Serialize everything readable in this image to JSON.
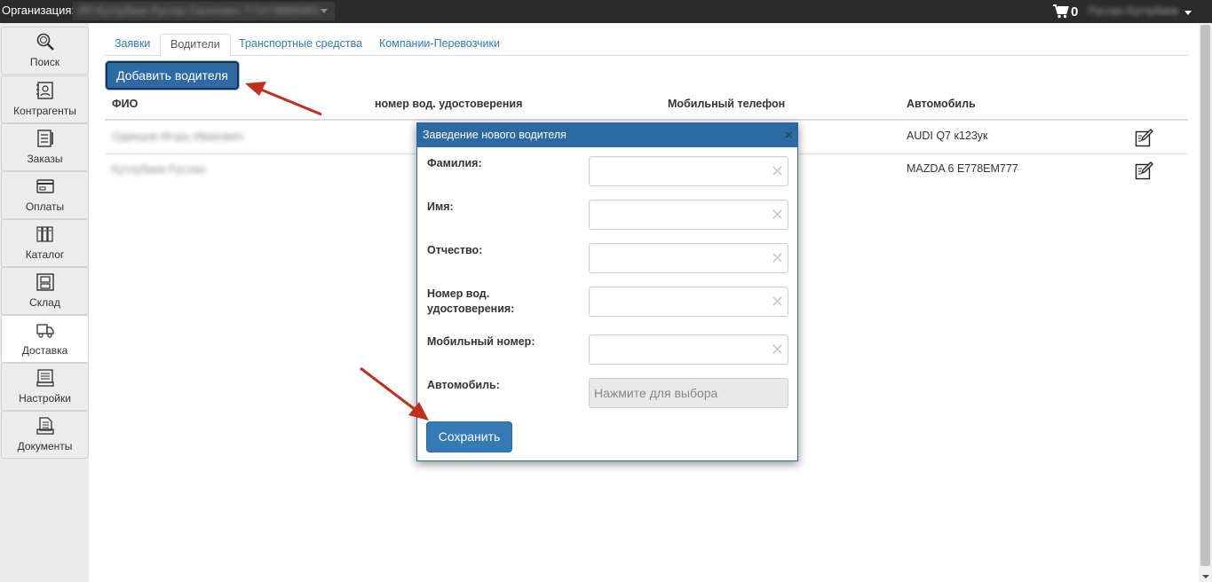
{
  "topbar": {
    "org_label": "Организация:",
    "org_value": "ИП Кутлубаев Руслан Сагитович 7714736855901",
    "cart_count": "0",
    "user_name": "Руслан Кутлубаев"
  },
  "sidebar": {
    "items": [
      {
        "label": "Поиск",
        "icon": "search-icon"
      },
      {
        "label": "Контрагенты",
        "icon": "contacts-icon"
      },
      {
        "label": "Заказы",
        "icon": "orders-icon"
      },
      {
        "label": "Оплаты",
        "icon": "payments-icon"
      },
      {
        "label": "Каталог",
        "icon": "catalog-icon"
      },
      {
        "label": "Склад",
        "icon": "warehouse-icon"
      },
      {
        "label": "Доставка",
        "icon": "delivery-icon"
      },
      {
        "label": "Настройки",
        "icon": "settings-icon"
      },
      {
        "label": "Документы",
        "icon": "documents-icon"
      }
    ],
    "active": "Доставка"
  },
  "tabs": [
    {
      "label": "Заявки"
    },
    {
      "label": "Водители"
    },
    {
      "label": "Транспортные средства"
    },
    {
      "label": "Компании-Перевозчики"
    }
  ],
  "active_tab": "Водители",
  "add_button": "Добавить водителя",
  "table": {
    "headers": [
      "ФИО",
      "номер вод. удостоверения",
      "Мобильный телефон",
      "Автомобиль"
    ],
    "rows": [
      {
        "name": "Одинцов Игорь Иванович",
        "license": "",
        "phone": "",
        "car": "AUDI Q7 к123ук"
      },
      {
        "name": "Кутлубаев Руслан",
        "license": "",
        "phone": "",
        "car": "MAZDA 6 Е778ЕМ777"
      }
    ]
  },
  "dialog": {
    "title": "Заведение нового водителя",
    "close": "×",
    "fields": [
      {
        "label": "Фамилия:",
        "value": ""
      },
      {
        "label": "Имя:",
        "value": ""
      },
      {
        "label": "Отчество:",
        "value": ""
      },
      {
        "label_line1": "Номер вод.",
        "label_line2": "удостоверения:",
        "value": ""
      },
      {
        "label": "Мобильный номер:",
        "value": ""
      }
    ],
    "car_label": "Автомобиль:",
    "car_placeholder": "Нажмите для выбора",
    "save": "Сохранить"
  },
  "colors": {
    "topbar": "#2b2b2b",
    "accent": "#2d6aa3",
    "link": "#337ab7",
    "annotation_arrow": "#c0301f"
  }
}
